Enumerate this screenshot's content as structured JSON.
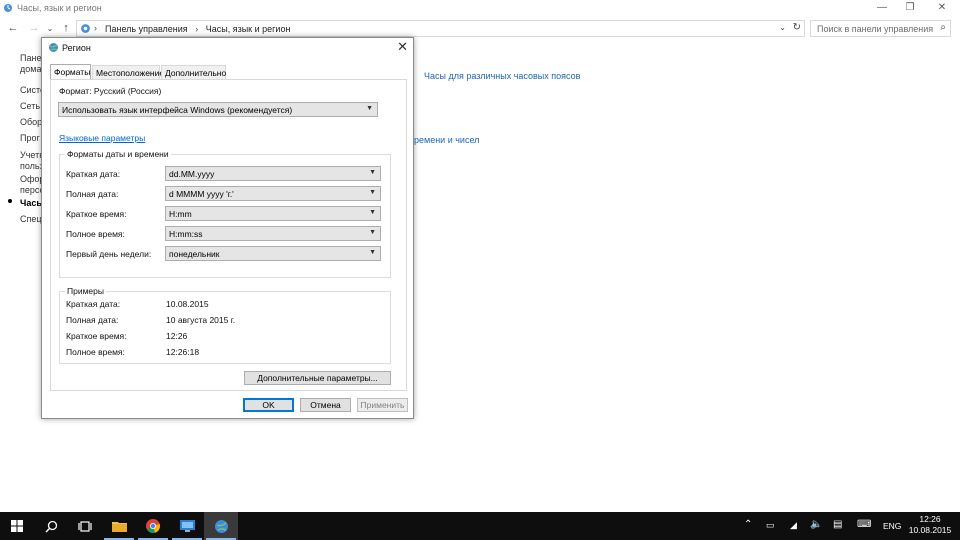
{
  "window": {
    "title": "Часы, язык и регион",
    "breadcrumb": [
      "Панель управления",
      "Часы, язык и регион"
    ],
    "search_placeholder": "Поиск в панели управления"
  },
  "background": {
    "sidebar_fragments": [
      "Пане",
      "дома",
      "Систе",
      "Сеть",
      "Обор",
      "Прог",
      "Учетн",
      "польз",
      "Офор",
      "персо",
      "Часы",
      "Специ"
    ],
    "link_timezones": "Часы для различных часовых поясов",
    "link_time_numbers": "ремени и чисел"
  },
  "dialog": {
    "title": "Регион",
    "tabs": [
      "Форматы",
      "Местоположение",
      "Дополнительно"
    ],
    "format_label": "Формат: Русский (Россия)",
    "format_value": "Использовать язык интерфейса Windows (рекомендуется)",
    "lang_link": "Языковые параметры",
    "datetime_group": "Форматы даты и времени",
    "fields": [
      {
        "label": "Краткая дата:",
        "value": "dd.MM.yyyy"
      },
      {
        "label": "Полная дата:",
        "value": "d MMMM yyyy 'г.'"
      },
      {
        "label": "Краткое время:",
        "value": "H:mm"
      },
      {
        "label": "Полное время:",
        "value": "H:mm:ss"
      },
      {
        "label": "Первый день недели:",
        "value": "понедельник"
      }
    ],
    "examples_group": "Примеры",
    "examples": [
      {
        "label": "Краткая дата:",
        "value": "10.08.2015"
      },
      {
        "label": "Полная дата:",
        "value": "10 августа 2015 г."
      },
      {
        "label": "Краткое время:",
        "value": "12:26"
      },
      {
        "label": "Полное время:",
        "value": "12:26:18"
      }
    ],
    "additional_button": "Дополнительные параметры...",
    "ok": "OK",
    "cancel": "Отмена",
    "apply": "Применить"
  },
  "taskbar": {
    "lang": "ENG",
    "time": "12:26",
    "date": "10.08.2015"
  }
}
